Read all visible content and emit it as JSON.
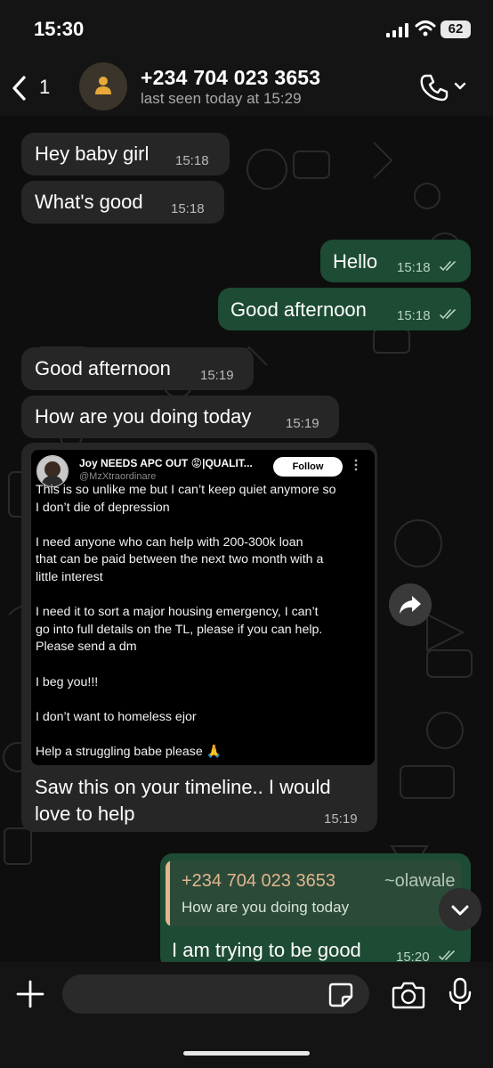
{
  "status_bar": {
    "time": "15:30",
    "battery": "62"
  },
  "header": {
    "back_count": "1",
    "contact_name": "+234 704 023 3653",
    "last_seen": "last seen today at 15:29"
  },
  "messages": [
    {
      "direction": "incoming",
      "text": "Hey baby girl",
      "time": "15:18"
    },
    {
      "direction": "incoming",
      "text": "What's good",
      "time": "15:18"
    },
    {
      "direction": "outgoing",
      "text": "Hello",
      "time": "15:18",
      "read": true
    },
    {
      "direction": "outgoing",
      "text": "Good afternoon",
      "time": "15:18",
      "read": true
    },
    {
      "direction": "incoming",
      "text": "Good afternoon",
      "time": "15:19"
    },
    {
      "direction": "incoming",
      "text": "How are you doing today",
      "time": "15:19"
    },
    {
      "direction": "incoming",
      "text_lines": [
        "Saw this on your timeline.. I would",
        "love to help"
      ],
      "time": "15:19"
    },
    {
      "direction": "outgoing",
      "text": "I am trying to be good",
      "time": "15:20",
      "read": true
    }
  ],
  "tweet": {
    "author": "Joy NEEDS APC OUT 😡|QUALIT...",
    "handle": "@MzXtraordinare",
    "follow_label": "Follow",
    "body_lines": [
      "This is so unlike me but I can’t keep quiet anymore so",
      "I don’t die of depression",
      "",
      "I need anyone who can help with 200-300k loan",
      "that can be paid between the next two month with a",
      "little interest",
      "",
      "I need it to sort a major housing  emergency, I can’t",
      "go into full details on the TL, please if you can help.",
      "Please send a dm",
      "",
      "I beg you!!!",
      "",
      "I don’t want to homeless ejor",
      "",
      "Help a struggling babe please  🙏"
    ]
  },
  "reply_quote": {
    "name": "+234 704 023 3653",
    "alias": "~olawale",
    "text": "How are you doing today"
  },
  "composer": {
    "placeholder": ""
  },
  "colors": {
    "incoming_bubble": "#262626",
    "outgoing_bubble": "#1d4b33",
    "quote_accent": "#e1b590",
    "background": "#0e0e0e"
  },
  "icons": {
    "back": "chevron-left-icon",
    "avatar": "person-icon",
    "call": "phone-icon",
    "forward": "forward-arrow-icon",
    "scroll": "chevron-down-icon",
    "attach": "plus-icon",
    "sticker": "sticker-icon",
    "camera": "camera-icon",
    "mic": "microphone-icon"
  }
}
